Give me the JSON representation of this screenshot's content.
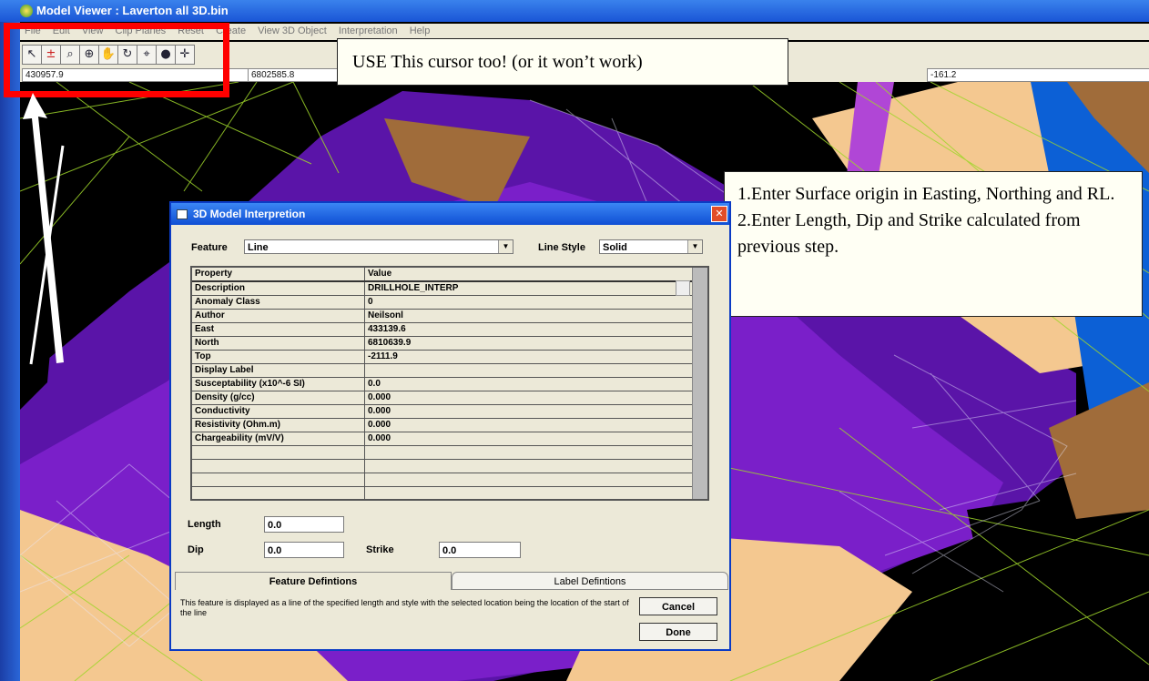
{
  "window": {
    "title": "Model Viewer : Laverton all 3D.bin"
  },
  "menu": [
    "File",
    "Edit",
    "View",
    "Clip Planes",
    "Reset",
    "Create",
    "View 3D Object",
    "Interpretation",
    "Help"
  ],
  "toolbar": {
    "icons": [
      "pointer-icon",
      "pick-point-icon",
      "zoom-icon",
      "zoom-in-icon",
      "pan-hand-icon",
      "rotate-icon",
      "interpret-icon",
      "target-icon",
      "crosshair-icon"
    ]
  },
  "coords": {
    "easting": "430957.9",
    "northing": "6802585.8",
    "rl": "-161.2"
  },
  "annotations": {
    "note1": "USE This cursor too! (or it won’t work)",
    "note2_line1": "1.Enter Surface origin in Easting, Northing and RL.",
    "note2_line2": "2.Enter Length, Dip and Strike calculated from previous step."
  },
  "dialog": {
    "title": "3D Model Interpretion",
    "feature_label": "Feature",
    "feature_value": "Line",
    "line_style_label": "Line Style",
    "line_style_value": "Solid",
    "columns": [
      "Property",
      "Value"
    ],
    "rows": [
      [
        "Description",
        "DRILLHOLE_INTERP"
      ],
      [
        "Anomaly Class",
        "0"
      ],
      [
        "Author",
        "Neilsonl"
      ],
      [
        "East",
        "433139.6"
      ],
      [
        "North",
        "6810639.9"
      ],
      [
        "Top",
        "-2111.9"
      ],
      [
        "Display Label",
        ""
      ],
      [
        "Susceptability (x10^-6 SI)",
        "0.0"
      ],
      [
        "Density (g/cc)",
        "0.000"
      ],
      [
        "Conductivity",
        "0.000"
      ],
      [
        "Resistivity (Ohm.m)",
        "0.000"
      ],
      [
        "Chargeability (mV/V)",
        "0.000"
      ],
      [
        "",
        ""
      ],
      [
        "",
        ""
      ],
      [
        "",
        ""
      ],
      [
        "",
        ""
      ]
    ],
    "length_label": "Length",
    "length_value": "0.0",
    "dip_label": "Dip",
    "dip_value": "0.0",
    "strike_label": "Strike",
    "strike_value": "0.0",
    "tab_feature": "Feature Defintions",
    "tab_label": "Label Defintions",
    "description": "This feature is displayed as a line of the specified length and style with the selected location being the location of the start of the line",
    "cancel": "Cancel",
    "done": "Done"
  }
}
